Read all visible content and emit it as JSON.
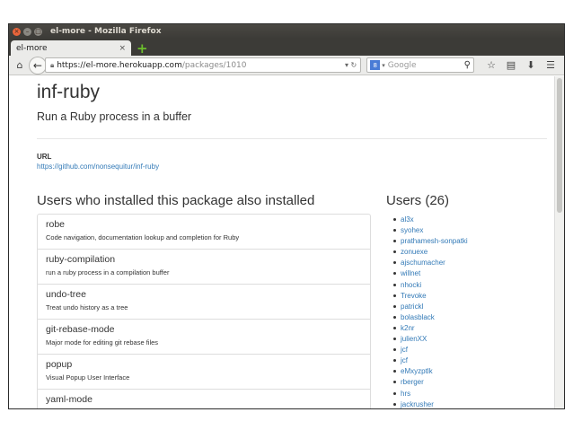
{
  "browser": {
    "window_title": "el-more - Mozilla Firefox",
    "tab_title": "el-more",
    "url_host": "https://el-more.herokuapp.com",
    "url_path": "/packages/1010",
    "search_placeholder": "Google",
    "search_engine_badge": "8"
  },
  "package": {
    "name": "inf-ruby",
    "description": "Run a Ruby process in a buffer",
    "url_label": "URL",
    "url": "https://github.com/nonsequitur/inf-ruby"
  },
  "also_installed": {
    "heading": "Users who installed this package also installed",
    "items": [
      {
        "name": "robe",
        "desc": "Code navigation, documentation lookup and completion for Ruby"
      },
      {
        "name": "ruby-compilation",
        "desc": "run a ruby process in a compilation buffer"
      },
      {
        "name": "undo-tree",
        "desc": "Treat undo history as a tree"
      },
      {
        "name": "git-rebase-mode",
        "desc": "Major mode for editing git rebase files"
      },
      {
        "name": "popup",
        "desc": "Visual Popup User Interface"
      },
      {
        "name": "yaml-mode",
        "desc": ""
      }
    ]
  },
  "users": {
    "heading": "Users (26)",
    "list": [
      "al3x",
      "syohex",
      "prathamesh-sonpatki",
      "zonuexe",
      "ajschumacher",
      "willnet",
      "nhocki",
      "Trevoke",
      "patrickl",
      "bolasblack",
      "k2nr",
      "julienXX",
      "jcf",
      "jcf",
      "eMxyzptlk",
      "rberger",
      "hrs",
      "jackrusher"
    ]
  }
}
